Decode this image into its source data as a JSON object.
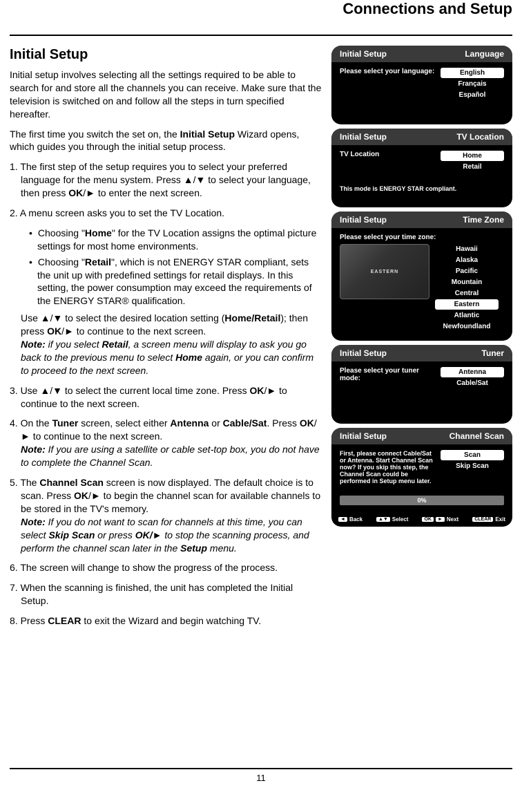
{
  "page_title": "Connections and Setup",
  "page_number": "11",
  "heading": "Initial Setup",
  "intro_p1": "Initial setup involves selecting all the settings required to be able to search for and store all the channels you can receive. Make sure that the television is switched on and follow all the steps in turn specified hereafter.",
  "intro_p2_a": "The first time you switch the set on, the ",
  "intro_p2_bold": "Initial Setup",
  "intro_p2_b": " Wizard opens, which guides you through the initial setup process.",
  "step1_a": "1. The first step of the setup requires you to select your preferred language for the menu system. Press ▲/▼ to select your language, then press ",
  "step1_bold": "OK",
  "step1_b": "/► to enter the next screen.",
  "step2_intro": "2. A menu screen asks you to set the TV Location.",
  "step2_bullet1_a": "Choosing \"",
  "step2_bullet1_bold": "Home",
  "step2_bullet1_b": "\" for the TV Location assigns the optimal picture settings for most home environments.",
  "step2_bullet2_a": "Choosing \"",
  "step2_bullet2_bold": "Retail",
  "step2_bullet2_b": "\", which is not ENERGY STAR compliant, sets the unit up with predefined settings for retail displays. In this setting, the power consumption may exceed the requirements of the ENERGY STAR® qualification.",
  "step2_use_a": "Use ▲/▼ to select the desired location setting (",
  "step2_use_bold": "Home/Retail",
  "step2_use_b": "); then press ",
  "step2_use_bold2": "OK",
  "step2_use_c": "/► to continue to the next screen.",
  "step2_note_label": "Note:",
  "step2_note_a": " if you select ",
  "step2_note_bold": "Retail",
  "step2_note_b": ", a screen menu will display to ask you go back to the previous menu to select ",
  "step2_note_bold2": "Home",
  "step2_note_c": " again, or you can confirm to proceed to the next screen.",
  "step3_a": "3. Use ▲/▼ to select the current local time zone. Press ",
  "step3_bold": "OK",
  "step3_b": "/► to continue to the next screen.",
  "step4_a": "4. On the ",
  "step4_bold1": "Tuner",
  "step4_b": " screen, select either ",
  "step4_bold2": "Antenna",
  "step4_c": " or ",
  "step4_bold3": "Cable/Sat",
  "step4_d": ". Press ",
  "step4_bold4": "OK",
  "step4_e": "/► to continue to the next screen.",
  "step4_note_label": "Note:",
  "step4_note": " If you are using a satellite or cable set-top box, you do not have to complete the Channel Scan.",
  "step5_a": "5. The ",
  "step5_bold1": "Channel Scan",
  "step5_b": " screen is now displayed. The default choice is to scan. Press ",
  "step5_bold2": "OK",
  "step5_c": "/► to begin the channel scan for available channels to be stored in the TV's memory.",
  "step5_note_label": "Note:",
  "step5_note_a": " If you do not want to scan for channels at this time, you can select ",
  "step5_note_bold1": "Skip Scan",
  "step5_note_b": " or press ",
  "step5_note_bold2": "OK/►",
  "step5_note_c": " to stop the scanning process, and perform the channel scan later in the ",
  "step5_note_bold3": "Setup",
  "step5_note_d": " menu.",
  "step6": "6. The screen will change to show the progress of the process.",
  "step7": "7. When the scanning is finished, the unit has completed the Initial Setup.",
  "step8_a": "8. Press ",
  "step8_bold": "CLEAR",
  "step8_b": " to exit the Wizard and begin watching TV.",
  "osd": {
    "language": {
      "title": "Initial Setup",
      "subtitle": "Language",
      "prompt": "Please select your language:",
      "options": [
        "English",
        "Français",
        "Español"
      ],
      "selected_index": 0
    },
    "location": {
      "title": "Initial Setup",
      "subtitle": "TV Location",
      "prompt": "TV Location",
      "options": [
        "Home",
        "Retail"
      ],
      "selected_index": 0,
      "note": "This mode is ENERGY STAR compliant."
    },
    "timezone": {
      "title": "Initial Setup",
      "subtitle": "Time Zone",
      "prompt": "Please select your time zone:",
      "map_label": "EASTERN",
      "options": [
        "Hawaii",
        "Alaska",
        "Pacific",
        "Mountain",
        "Central",
        "Eastern",
        "Atlantic",
        "Newfoundland"
      ],
      "selected_index": 5
    },
    "tuner": {
      "title": "Initial Setup",
      "subtitle": "Tuner",
      "prompt": "Please select your tuner mode:",
      "options": [
        "Antenna",
        "Cable/Sat"
      ],
      "selected_index": 0
    },
    "scan": {
      "title": "Initial Setup",
      "subtitle": "Channel Scan",
      "prompt": "First, please connect Cable/Sat or Antenna. Start Channel Scan now? If you skip this step, the Channel Scan could be performed in Setup menu later.",
      "options": [
        "Scan",
        "Skip Scan"
      ],
      "selected_index": 0,
      "progress": "0%",
      "hints": {
        "back": "Back",
        "select": "Select",
        "next": "Next",
        "exit": "Exit",
        "ok_key": "OK",
        "clear_key": "CLEAR"
      }
    }
  }
}
